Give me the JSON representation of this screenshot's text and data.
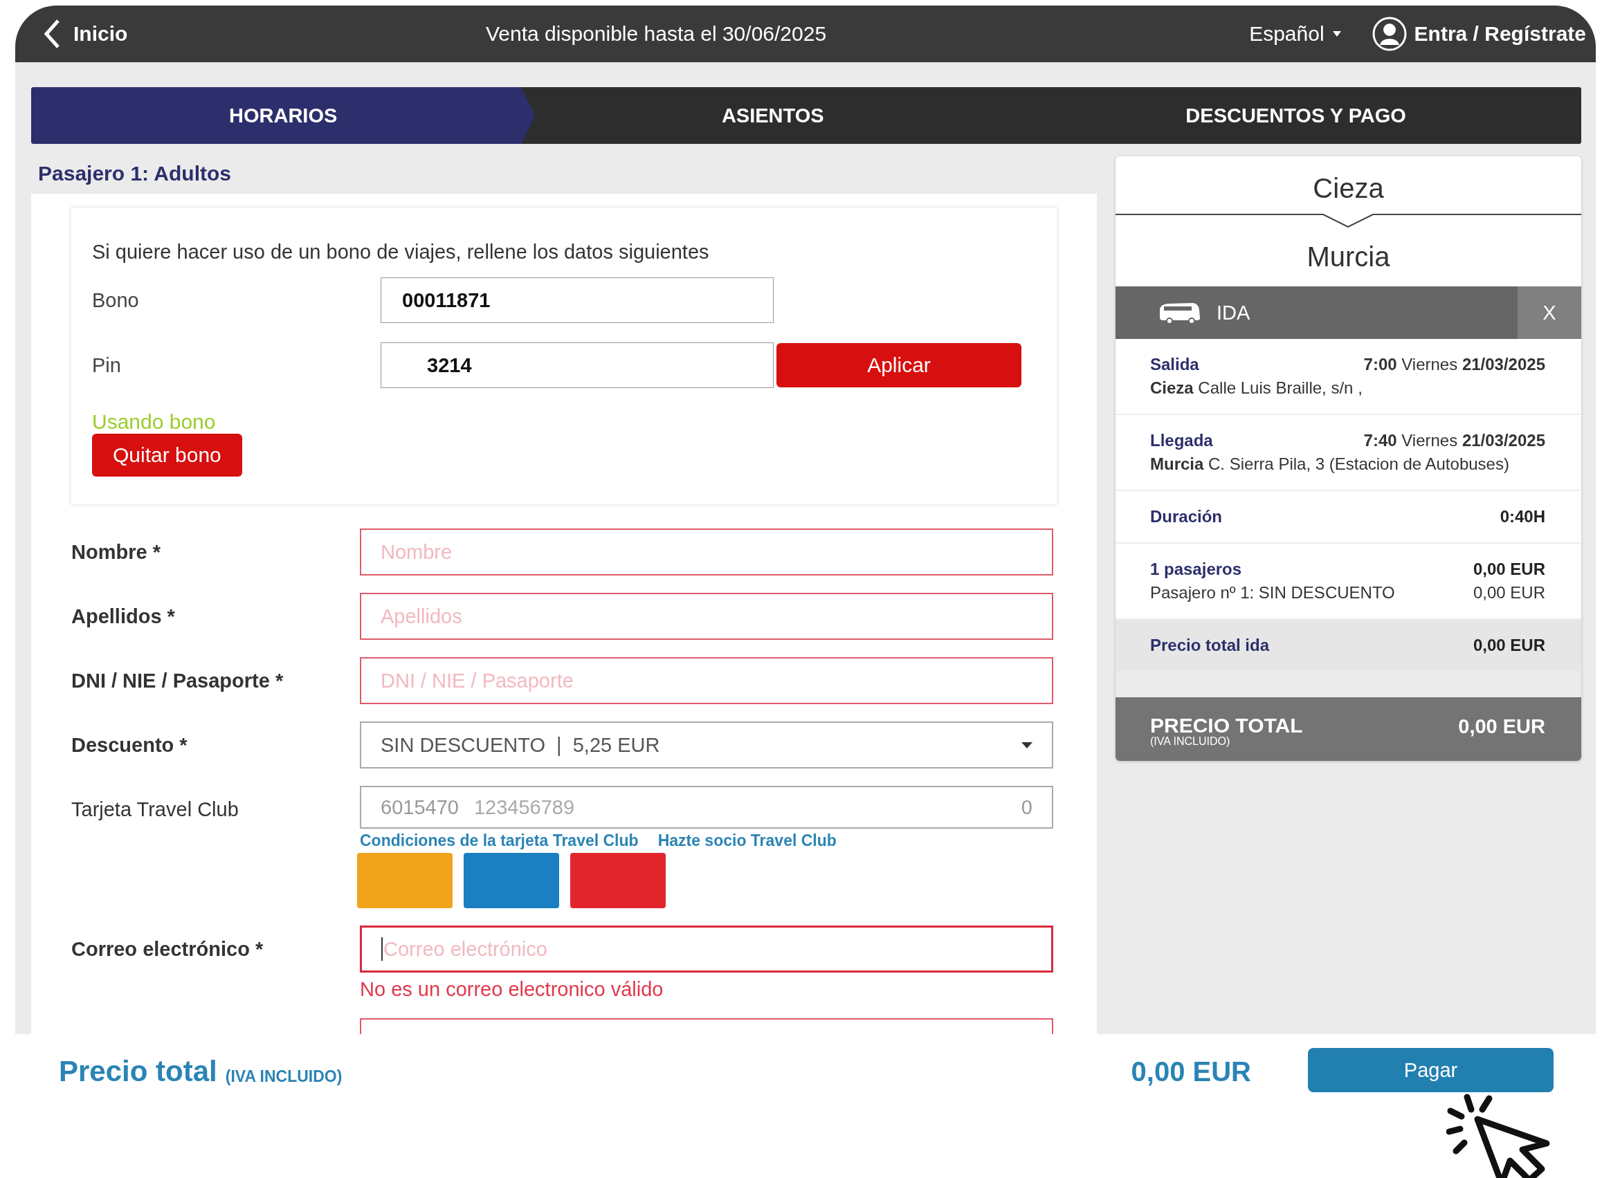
{
  "top_bar": {
    "back_label": "Inicio",
    "notice": "Venta disponible hasta el 30/06/2025",
    "language": "Español",
    "login": "Entra / Regístrate"
  },
  "steps": [
    {
      "label": "HORARIOS",
      "selected": true
    },
    {
      "label": "ASIENTOS",
      "selected": false
    },
    {
      "label": "DESCUENTOS Y PAGO",
      "selected": false
    }
  ],
  "passenger_title": "Pasajero 1: Adultos",
  "bono": {
    "intro": "Si quiere hacer uso de un bono de viajes, rellene los datos siguientes",
    "fields": [
      {
        "label": "Bono",
        "value": "00011871"
      },
      {
        "label": "Pin",
        "value": "3214"
      }
    ],
    "apply_button": "Aplicar",
    "status": "Usando bono",
    "remove_button": "Quitar bono"
  },
  "form": {
    "rows": [
      {
        "kind": "text",
        "label": "Nombre *",
        "required": true,
        "placeholder": "Nombre",
        "invalid": true
      },
      {
        "kind": "text",
        "label": "Apellidos *",
        "required": true,
        "placeholder": "Apellidos",
        "invalid": true
      },
      {
        "kind": "text",
        "label": "DNI / NIE / Pasaporte *",
        "required": true,
        "placeholder": "DNI / NIE / Pasaporte",
        "invalid": true
      },
      {
        "kind": "select",
        "label": "Descuento *",
        "required": true,
        "value": "SIN DESCUENTO  |  5,25 EUR",
        "invalid": false
      },
      {
        "kind": "card",
        "label": "Tarjeta Travel Club",
        "required": false,
        "prefix": "6015470",
        "placeholder": "123456789",
        "suffix": "0",
        "links": [
          "Condiciones de la tarjeta Travel Club",
          "Hazte socio Travel Club"
        ],
        "cards": [
          {
            "color": "#f2a31c"
          },
          {
            "color": "#1b7fc2"
          },
          {
            "color": "#e2262d"
          }
        ]
      },
      {
        "kind": "text",
        "label": "Correo electrónico *",
        "required": true,
        "placeholder": "Correo electrónico",
        "invalid": true,
        "focused": true,
        "error": "No es un correo electronico válido"
      },
      {
        "kind": "text",
        "invalid": true
      }
    ]
  },
  "summary": {
    "origin": "Cieza",
    "destination": "Murcia",
    "leg": {
      "label": "IDA",
      "close": "X"
    },
    "departure": {
      "title": "Salida",
      "when": "**7:00** Viernes **21/03/2025**",
      "place": "**Cieza**  Calle Luis Braille, s/n ,"
    },
    "arrival": {
      "title": "Llegada",
      "when": "**7:40** Viernes **21/03/2025**",
      "place": "**Murcia**  C. Sierra Pila, 3 (Estacion de Autobuses)"
    },
    "duration": {
      "label": "Duración",
      "value": "0:40H"
    },
    "passengers": {
      "label": "1 pasajeros",
      "amount": "0,00 EUR",
      "detail": "Pasajero nº 1: SIN DESCUENTO",
      "detail_amount": "0,00 EUR"
    },
    "subtotal": {
      "label": "Precio total ida",
      "amount": "0,00 EUR"
    },
    "total": {
      "label": "PRECIO TOTAL",
      "note": "(IVA INCLUIDO)",
      "amount": "0,00 EUR"
    }
  },
  "footer": {
    "label": "Precio total",
    "note": "(IVA INCLUIDO)",
    "amount": "0,00 EUR",
    "button": "Pagar"
  }
}
